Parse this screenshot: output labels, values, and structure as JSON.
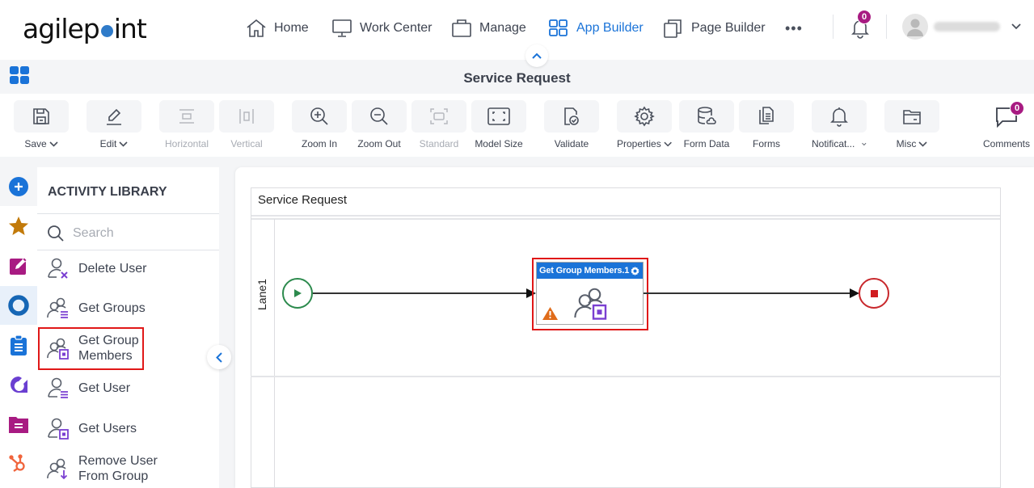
{
  "brand": {
    "logo_left": "agilep",
    "logo_right": "int",
    "accent": "#1a73d8",
    "badge_color": "#a81b82"
  },
  "topnav": {
    "items": [
      {
        "label": "Home",
        "icon": "home-icon"
      },
      {
        "label": "Work Center",
        "icon": "monitor-icon"
      },
      {
        "label": "Manage",
        "icon": "briefcase-icon"
      },
      {
        "label": "App Builder",
        "icon": "grid-icon",
        "active": true
      },
      {
        "label": "Page Builder",
        "icon": "pages-icon"
      }
    ],
    "more": "•••",
    "notifications_count": "0"
  },
  "header": {
    "title": "Service Request"
  },
  "toolbar": {
    "items": [
      {
        "label": "Save",
        "dropdown": true
      },
      {
        "label": "Edit",
        "dropdown": true
      },
      {
        "label": "Horizontal",
        "disabled": true
      },
      {
        "label": "Vertical",
        "disabled": true
      },
      {
        "label": "Zoom In"
      },
      {
        "label": "Zoom Out"
      },
      {
        "label": "Standard",
        "disabled": true
      },
      {
        "label": "Model Size"
      },
      {
        "label": "Validate"
      },
      {
        "label": "Properties",
        "dropdown": true
      },
      {
        "label": "Form Data"
      },
      {
        "label": "Forms"
      },
      {
        "label": "Notificat...",
        "dropdown": true
      },
      {
        "label": "Misc",
        "dropdown": true
      },
      {
        "label": "Comments"
      }
    ],
    "comments_count": "0"
  },
  "library": {
    "title": "ACTIVITY LIBRARY",
    "search_placeholder": "Search",
    "items": [
      {
        "label": "Delete User",
        "icon": "delete-user-icon"
      },
      {
        "label": "Get Groups",
        "icon": "get-groups-icon"
      },
      {
        "label": "Get Group Members",
        "icon": "get-group-members-icon",
        "highlighted": true
      },
      {
        "label": "Get User",
        "icon": "get-user-icon"
      },
      {
        "label": "Get Users",
        "icon": "get-users-icon"
      },
      {
        "label": "Remove User From Group",
        "icon": "remove-user-from-group-icon"
      }
    ]
  },
  "rail": {
    "items": [
      "add-icon",
      "star-icon",
      "edit-note-icon",
      "circle-icon",
      "clipboard-icon",
      "agilepoint-icon",
      "folder-doc-icon",
      "hubspot-icon"
    ]
  },
  "canvas": {
    "pool_title": "Service Request",
    "lane_label": "Lane1",
    "activity_label": "Get Group Members.1",
    "start_color": "#2c8a4d",
    "end_color": "#c8282c",
    "warning_color": "#e06c1a"
  }
}
